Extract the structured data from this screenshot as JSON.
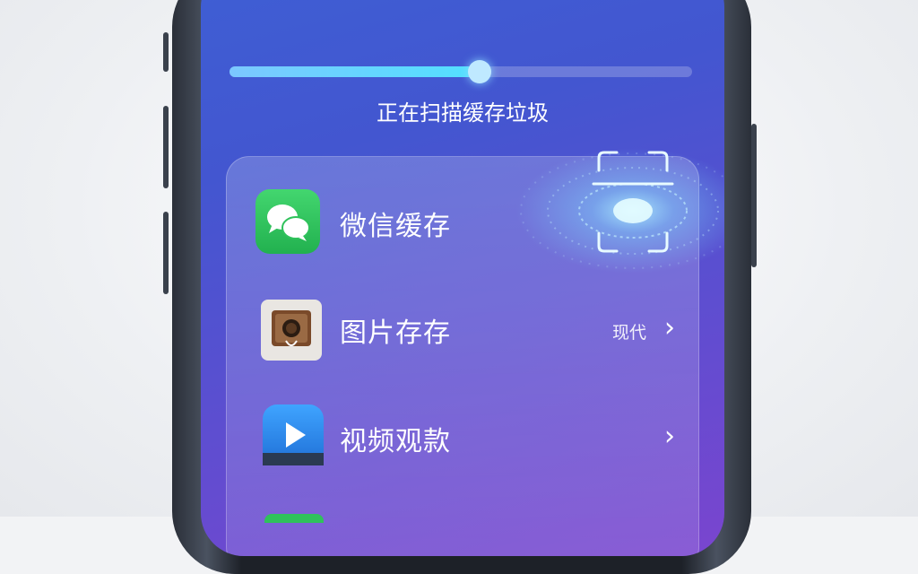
{
  "scan": {
    "progress": 0.54,
    "status_text": "正在扫描缓存垃圾"
  },
  "items": [
    {
      "label": "微信缓存",
      "icon": "wechat-icon",
      "meta": "",
      "chevron": ""
    },
    {
      "label": "图片存存",
      "icon": "photo-gallery-icon",
      "meta": "现代",
      "chevron": "›"
    },
    {
      "label": "视频观款",
      "icon": "video-player-icon",
      "meta": "",
      "chevron": "›"
    }
  ],
  "colors": {
    "screen_top": "#3e5fd4",
    "screen_bottom": "#7a45cf",
    "progress_accent": "#52e0ff",
    "wechat_green": "#2fc25b",
    "video_blue": "#2e8ef0"
  }
}
